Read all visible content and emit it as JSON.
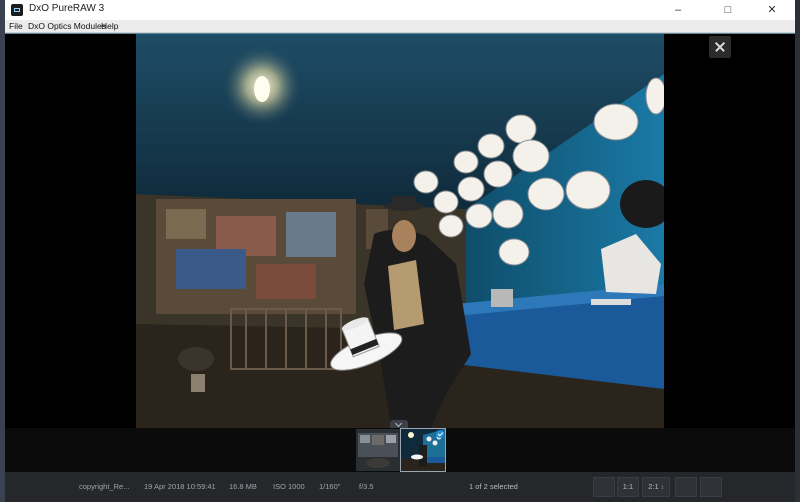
{
  "window": {
    "title": "DxO PureRAW 3"
  },
  "menu": {
    "file": "File",
    "optics": "DxO Optics Modules",
    "help": "Help"
  },
  "viewer": {
    "close_icon": "close-icon"
  },
  "filmstrip": {
    "thumbs": [
      {
        "selected": false
      },
      {
        "selected": true
      }
    ]
  },
  "status": {
    "filename": "copyright_Re...",
    "date": "19 Apr 2018 10:59:41",
    "size": "16.8 MB",
    "iso": "ISO 1000",
    "shutter": "1/160\"",
    "aperture": "f/3.5",
    "selection": "1 of 2 selected",
    "zoom_fit": "1:1",
    "zoom_ratio": "2:1"
  }
}
